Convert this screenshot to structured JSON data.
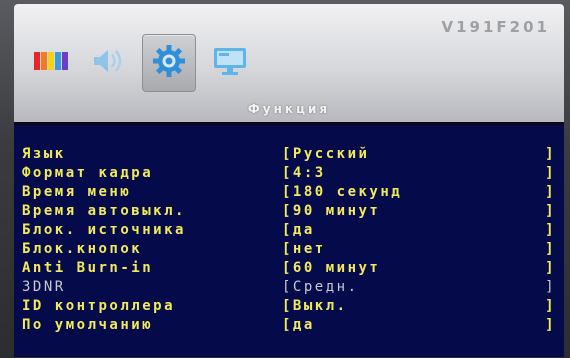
{
  "header": {
    "model": "V191F201",
    "icons": [
      {
        "name": "color-bars-icon",
        "selected": false
      },
      {
        "name": "audio-icon",
        "selected": false
      },
      {
        "name": "gear-icon",
        "selected": true
      },
      {
        "name": "monitor-icon",
        "selected": false
      }
    ],
    "section_title": "Функция"
  },
  "menu": {
    "items": [
      {
        "label": "Язык",
        "value": "[Русский",
        "close": "]"
      },
      {
        "label": "Формат кадра",
        "value": "[4:3",
        "close": "]"
      },
      {
        "label": "Время меню",
        "value": "[180 секунд",
        "close": "]"
      },
      {
        "label": "Время автовыкл.",
        "value": "[90 минут",
        "close": "]"
      },
      {
        "label": "Блок. источника",
        "value": "[да",
        "close": "]"
      },
      {
        "label": "Блок.кнопок",
        "value": "[нет",
        "close": "]"
      },
      {
        "label": "Anti Burn-in",
        "value": "[60 минут",
        "close": "]"
      },
      {
        "label": "3DNR",
        "value": "[Средн.",
        "close": "]"
      },
      {
        "label": "ID контроллера",
        "value": "[Выкл.",
        "close": "]"
      },
      {
        "label": "По умолчанию",
        "value": "[да",
        "close": "]"
      }
    ]
  },
  "colors": {
    "panel_bg": "#050b4a",
    "text_yellow": "#f2ea5a",
    "text_dim": "#c9c9cf"
  }
}
